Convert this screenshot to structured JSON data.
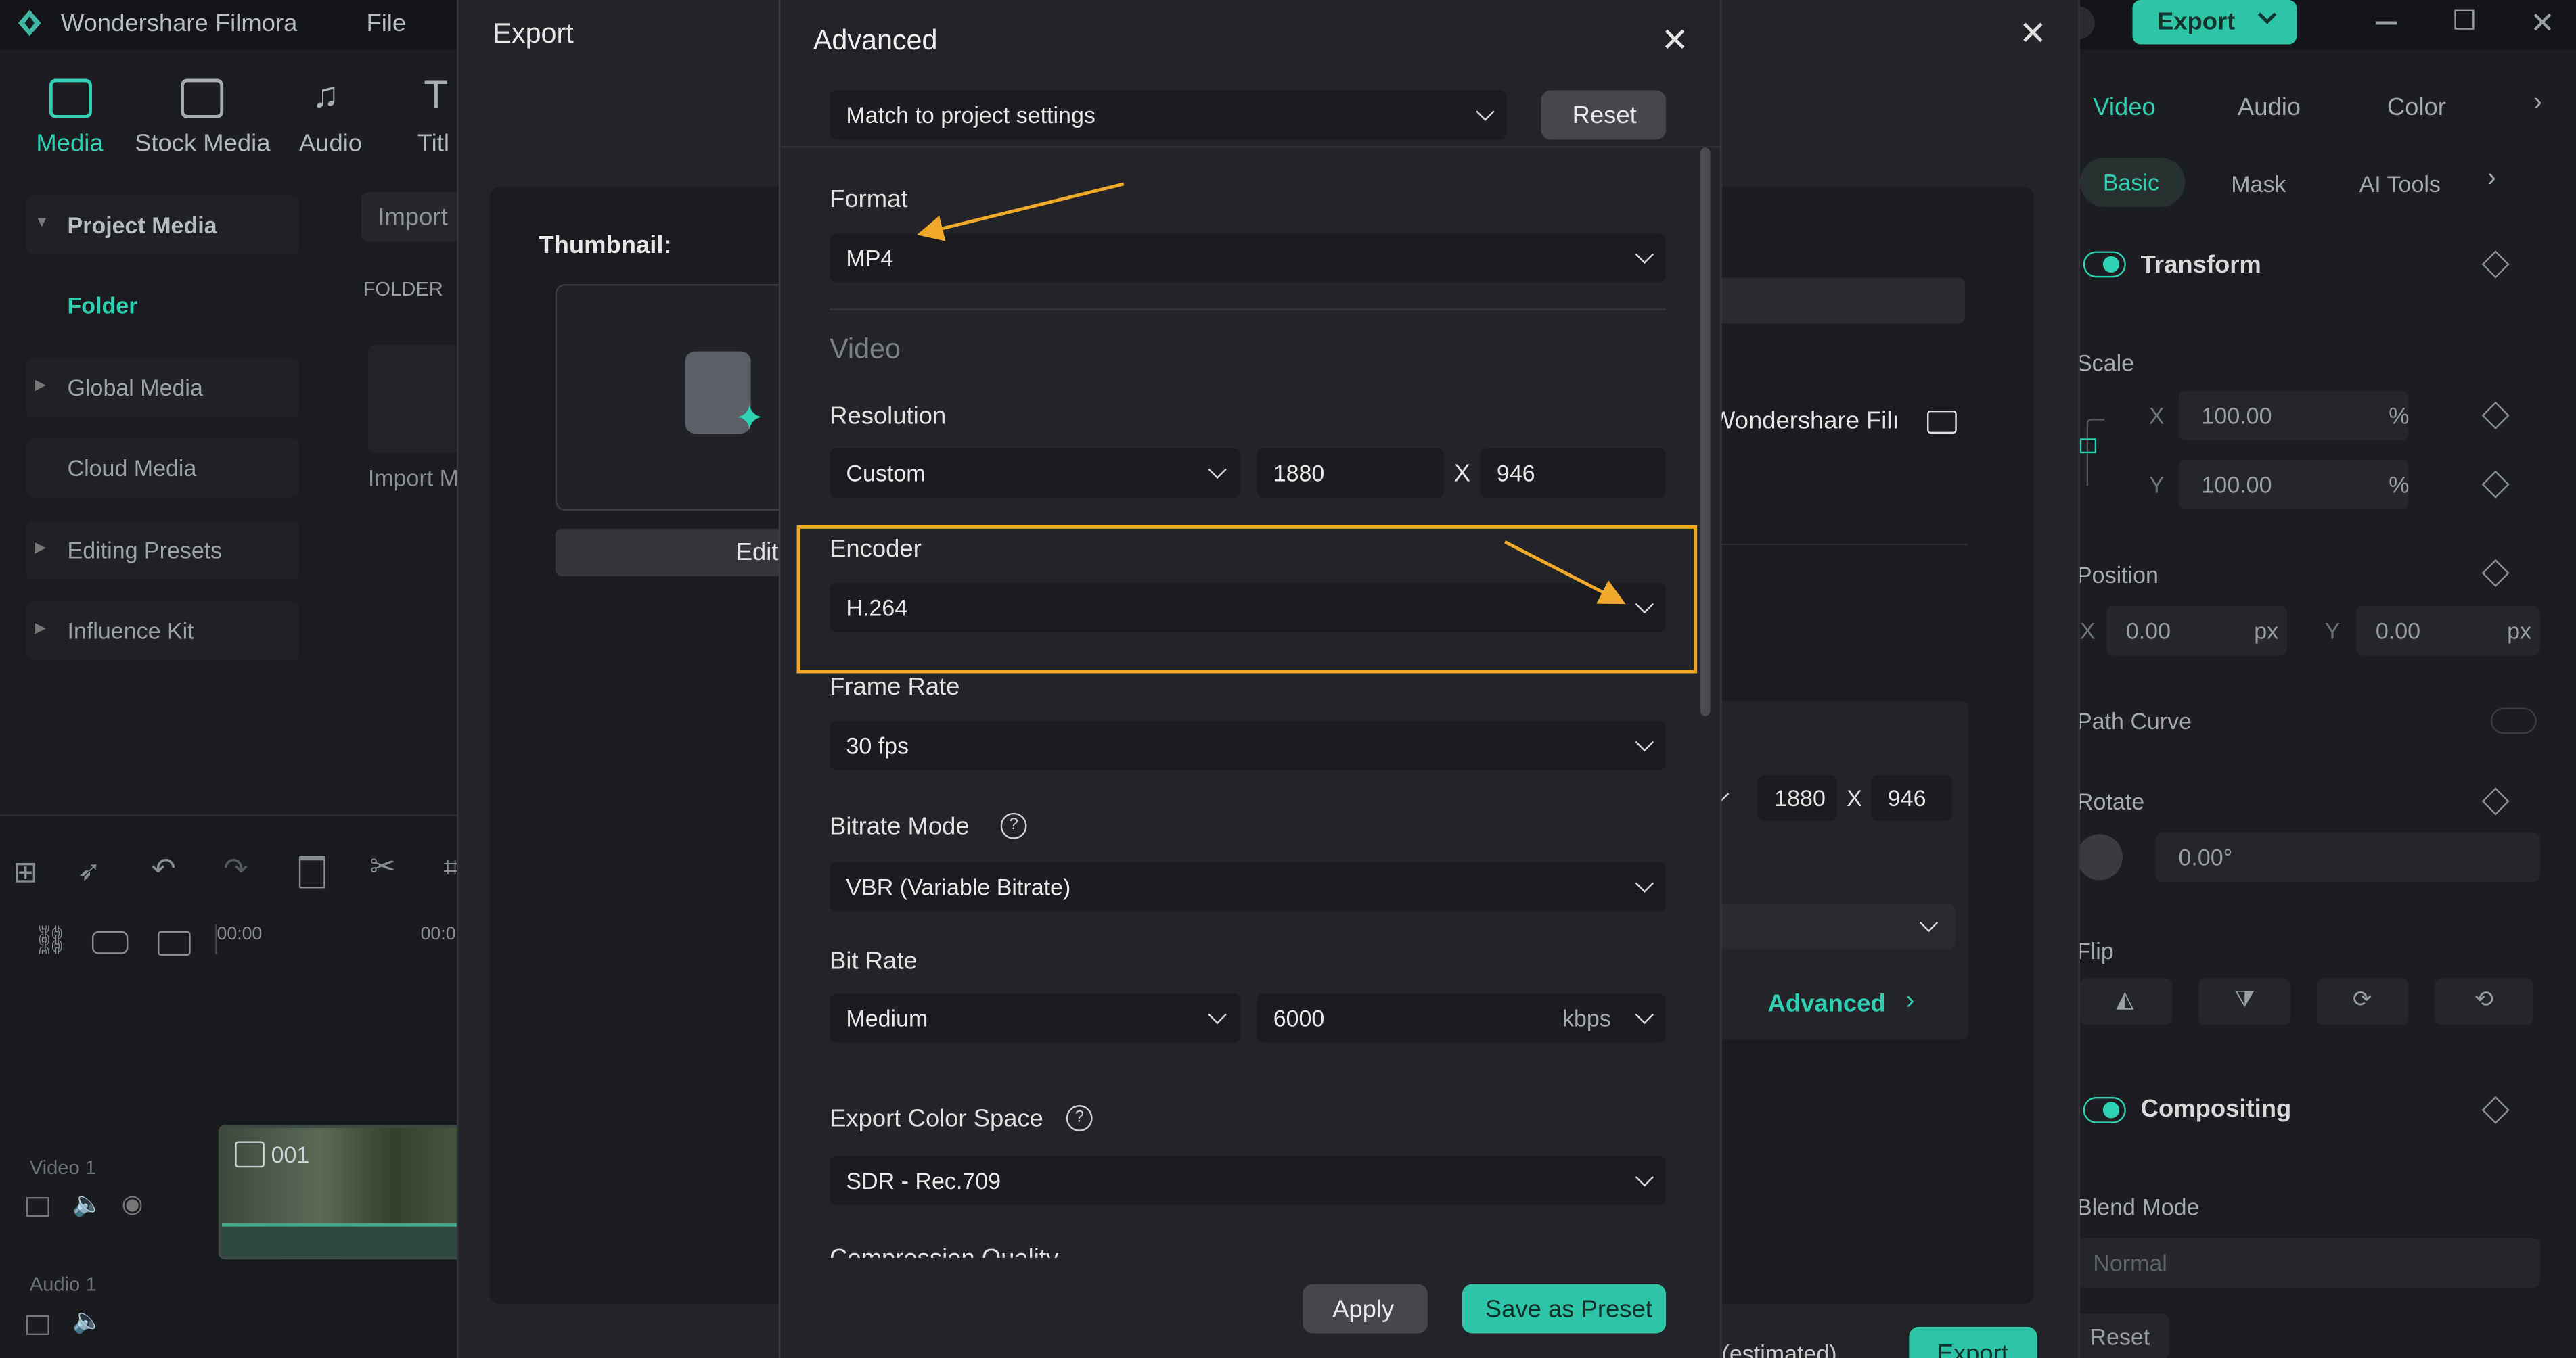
{
  "app": {
    "title": "Wondershare Filmora",
    "menu_file": "File",
    "export_button": "Export"
  },
  "media_tabs": [
    "Media",
    "Stock Media",
    "Audio",
    "Titl"
  ],
  "sidebar": {
    "items": [
      {
        "label": "Project Media",
        "caret": "▼"
      },
      {
        "label": "Folder"
      },
      {
        "label": "Global Media",
        "caret": "▶"
      },
      {
        "label": "Cloud Media"
      },
      {
        "label": "Editing Presets",
        "caret": "▶"
      },
      {
        "label": "Influence Kit",
        "caret": "▶"
      }
    ],
    "import_label": "Import",
    "folder_header": "FOLDER",
    "import_media_label": "Import M"
  },
  "timeline": {
    "time_start": "00:00",
    "time_next": "00:0",
    "clip_label": "001",
    "video_track": "Video 1",
    "audio_track": "Audio 1"
  },
  "props": {
    "tabs": [
      "Video",
      "Audio",
      "Color"
    ],
    "subtabs": [
      "Basic",
      "Mask",
      "AI Tools"
    ],
    "transform": "Transform",
    "scale": "Scale",
    "scale_x_label": "X",
    "scale_x": "100.00",
    "scale_y_label": "Y",
    "scale_y": "100.00",
    "percent": "%",
    "position": "Position",
    "pos_x_label": "X",
    "pos_x": "0.00",
    "pos_y_label": "Y",
    "pos_y": "0.00",
    "px": "px",
    "path_curve": "Path Curve",
    "rotate": "Rotate",
    "rotate_value": "0.00°",
    "flip": "Flip",
    "compositing": "Compositing",
    "blend_mode": "Blend Mode",
    "blend_value": "Normal",
    "reset": "Reset"
  },
  "export_dialog": {
    "title": "Export",
    "thumbnail_label": "Thumbnail:",
    "edit_button": "Edit",
    "save_path": "Wondershare Filı",
    "res_w": "1880",
    "res_x": "X",
    "res_h": "946",
    "advanced_link": "Advanced",
    "estimated": "(estimated)",
    "export_button": "Export"
  },
  "advanced": {
    "title": "Advanced",
    "preset": "Match to project settings",
    "reset_button": "Reset",
    "format_label": "Format",
    "format_value": "MP4",
    "video_section": "Video",
    "resolution_label": "Resolution",
    "resolution_value": "Custom",
    "res_w": "1880",
    "res_x": "X",
    "res_h": "946",
    "encoder_label": "Encoder",
    "encoder_value": "H.264",
    "frame_rate_label": "Frame Rate",
    "frame_rate_value": "30 fps",
    "bitrate_mode_label": "Bitrate Mode",
    "bitrate_mode_value": "VBR (Variable Bitrate)",
    "bit_rate_label": "Bit Rate",
    "bit_rate_value": "Medium",
    "bit_rate_number": "6000",
    "bit_rate_unit": "kbps",
    "color_space_label": "Export Color Space",
    "color_space_value": "SDR - Rec.709",
    "cut_off_label": "Compression Quality",
    "apply_button": "Apply",
    "save_preset_button": "Save as Preset"
  },
  "colors": {
    "accent_teal": "#2fd0b3",
    "highlight_orange": "#f5a623",
    "arrow_orange": "#f0a92a"
  }
}
